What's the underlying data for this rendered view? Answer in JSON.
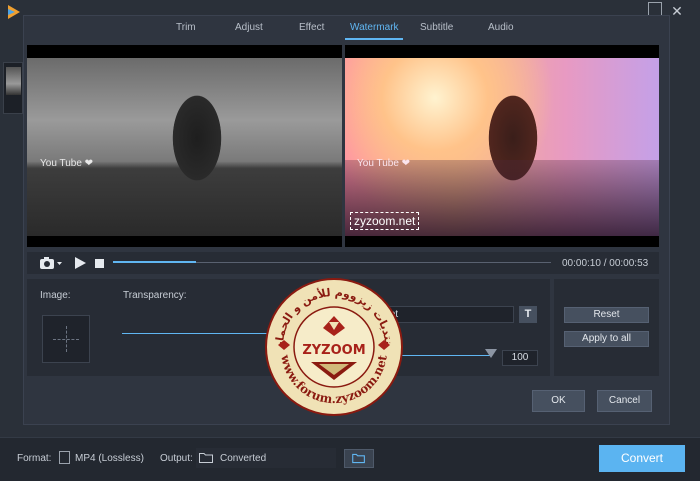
{
  "app": {
    "close_glyph": "✕"
  },
  "tabs": [
    {
      "label": "Trim",
      "active": false
    },
    {
      "label": "Adjust",
      "active": false
    },
    {
      "label": "Effect",
      "active": false
    },
    {
      "label": "Watermark",
      "active": true
    },
    {
      "label": "Subtitle",
      "active": false
    },
    {
      "label": "Audio",
      "active": false
    }
  ],
  "preview": {
    "overlay_text_left": "You Tube ❤",
    "overlay_text_right": "You Tube ❤",
    "watermark_text": "zyzoom.net"
  },
  "playback": {
    "current_time": "00:00:10",
    "duration": "00:00:53",
    "time_display": "00:00:10 / 00:00:53",
    "progress_fraction": 0.19
  },
  "watermark_settings": {
    "image_label": "Image:",
    "transparency_label": "Transparency:",
    "text_value": "zyzoom.net",
    "text_style_button": "T",
    "size_value": "100"
  },
  "side_buttons": {
    "reset_label": "Reset",
    "apply_label": "Apply to all"
  },
  "dialog_buttons": {
    "ok_label": "OK",
    "cancel_label": "Cancel"
  },
  "bottom_bar": {
    "format_label": "Format:",
    "format_value": "MP4 (Lossless)",
    "output_label": "Output:",
    "output_value": "Converted",
    "convert_label": "Convert"
  },
  "stamp": {
    "arc_top": "منتديات زيزووم للأمن و الحماية",
    "center": "ZYZOOM",
    "arc_bottom": "www.forum.zyzoom.net"
  },
  "colors": {
    "accent": "#60b6f2",
    "convert": "#5bb4f1",
    "dialog_bg": "#2f3540",
    "panel_bg": "#272c35",
    "stamp_fill": "#f0e2b6",
    "stamp_ink": "#8a1a10"
  }
}
